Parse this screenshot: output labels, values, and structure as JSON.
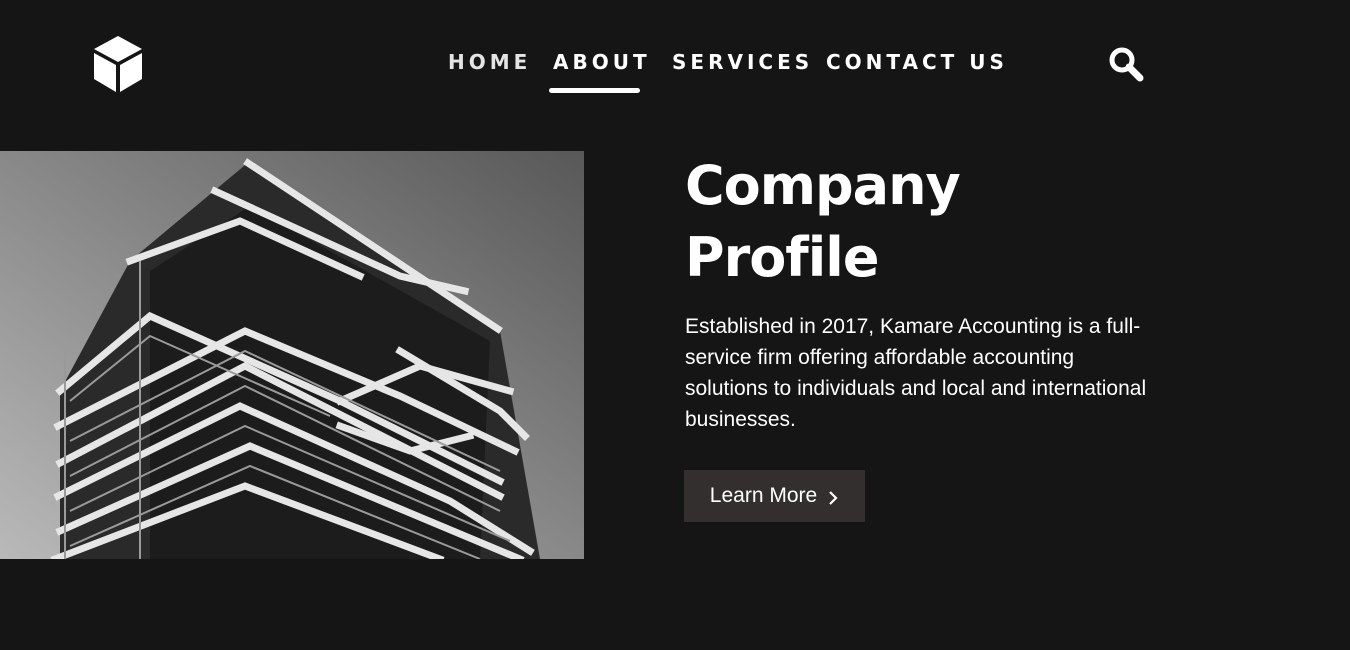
{
  "header": {
    "logo_icon": "cube-icon",
    "nav": [
      {
        "label": "HOME"
      },
      {
        "label": "ABOUT"
      },
      {
        "label": "SERVICES"
      },
      {
        "label": "CONTACT US"
      }
    ],
    "active_nav": "ABOUT",
    "search_icon": "search-icon"
  },
  "hero": {
    "image_subject": "building-photo",
    "title_line1": "Company",
    "title_line2": "Profile",
    "description": "Established in 2017, Kamare Accounting is a full-service firm offering affordable accounting solutions to individuals and local and international businesses.",
    "button_label": "Learn More",
    "button_icon": "chevron-right-icon"
  },
  "colors": {
    "background": "#151515",
    "text": "#ffffff",
    "button_bg": "#332f2e"
  }
}
